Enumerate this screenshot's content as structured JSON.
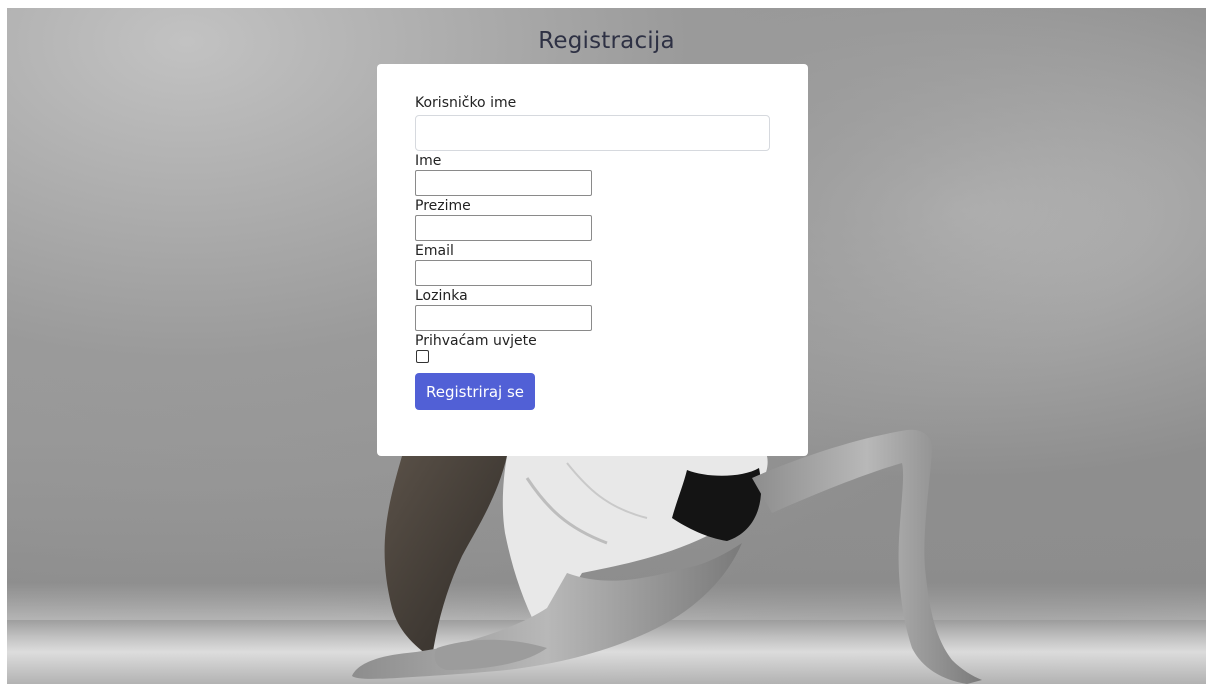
{
  "page": {
    "title": "Registracija"
  },
  "form": {
    "username": {
      "label": "Korisničko ime",
      "value": ""
    },
    "first_name": {
      "label": "Ime",
      "value": ""
    },
    "last_name": {
      "label": "Prezime",
      "value": ""
    },
    "email": {
      "label": "Email",
      "value": ""
    },
    "password": {
      "label": "Lozinka",
      "value": ""
    },
    "terms": {
      "label": "Prihvaćam uvjete",
      "checked": false
    },
    "submit_label": "Registriraj se"
  },
  "colors": {
    "accent": "#5160d6",
    "title_text": "#2e3144",
    "card_background": "#ffffff"
  }
}
